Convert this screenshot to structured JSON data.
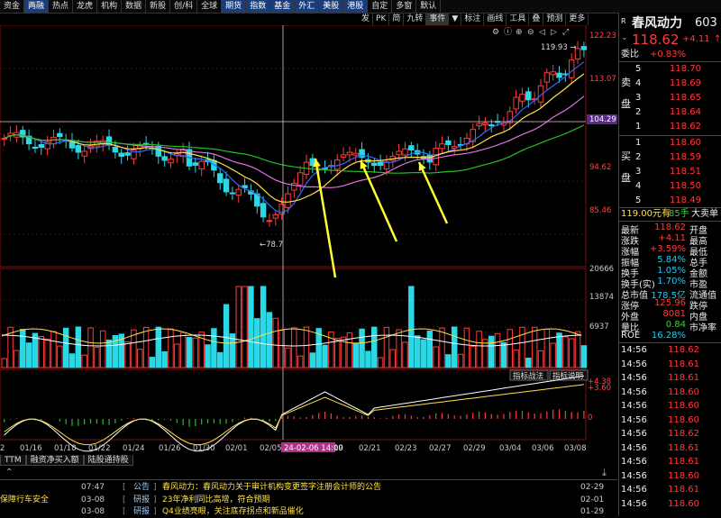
{
  "nav": [
    "资金",
    "两融",
    "热点",
    "龙虎",
    "机构",
    "数据",
    "新股",
    "创/科",
    "全球",
    "期货",
    "指数",
    "基金",
    "外汇",
    "美股",
    "港股",
    "自定",
    "多窗",
    "默认"
  ],
  "toolbar2": [
    "发",
    "PK",
    "简",
    "九转",
    "事件",
    "▼",
    "标注",
    "画线",
    "工具",
    "叠",
    "预测",
    "更多"
  ],
  "stock": {
    "name": "春风动力",
    "code": "603",
    "price": "118.62",
    "change": "+4.11",
    "r": "R",
    "wei_label": "委比",
    "wei_val": "+0.83%"
  },
  "asks": [
    {
      "n": "5",
      "p": "118.70"
    },
    {
      "n": "4",
      "p": "118.69"
    },
    {
      "n": "3",
      "p": "118.65"
    },
    {
      "n": "2",
      "p": "118.64"
    },
    {
      "n": "1",
      "p": "118.62"
    }
  ],
  "ask_label": [
    "卖",
    "盘"
  ],
  "bids": [
    {
      "n": "1",
      "p": "118.60"
    },
    {
      "n": "2",
      "p": "118.59"
    },
    {
      "n": "3",
      "p": "118.51"
    },
    {
      "n": "4",
      "p": "118.50"
    },
    {
      "n": "5",
      "p": "118.49"
    }
  ],
  "bid_label": [
    "买",
    "盘"
  ],
  "big": {
    "text": "119.00元有",
    "qty": "85手",
    "label": "大卖单"
  },
  "quote": [
    {
      "k": "最新",
      "v": "118.62",
      "k2": "开盘"
    },
    {
      "k": "涨跌",
      "v": "+4.11",
      "k2": "最高"
    },
    {
      "k": "涨幅",
      "v": "+3.59%",
      "k2": "最低"
    },
    {
      "k": "振幅",
      "v": "5.84%",
      "k2": "总手"
    },
    {
      "k": "换手",
      "v": "1.05%",
      "k2": "金额"
    },
    {
      "k": "换手(实)",
      "v": "1.70%",
      "k2": "市盈"
    },
    {
      "k": "总市值",
      "v": "178.5亿",
      "k2": "流通值"
    },
    {
      "k": "涨停",
      "v": "125.96",
      "k2": "跌停"
    },
    {
      "k": "外盘",
      "v": "8081",
      "k2": "内盘"
    },
    {
      "k": "量比",
      "v": "0.84",
      "k2": "市净率"
    },
    {
      "k": "ROE",
      "v": "16.28%",
      "k2": ""
    }
  ],
  "ticks": [
    {
      "t": "14:56",
      "p": "118.62"
    },
    {
      "t": "14:56",
      "p": "118.61"
    },
    {
      "t": "14:56",
      "p": "118.61"
    },
    {
      "t": "14:56",
      "p": "118.60"
    },
    {
      "t": "14:56",
      "p": "118.60"
    },
    {
      "t": "14:56",
      "p": "118.60"
    },
    {
      "t": "14:56",
      "p": "118.62"
    },
    {
      "t": "14:56",
      "p": "118.61"
    },
    {
      "t": "14:56",
      "p": "118.61"
    },
    {
      "t": "14:56",
      "p": "118.60"
    },
    {
      "t": "14:56",
      "p": "118.61"
    },
    {
      "t": "14:56",
      "p": "118.60"
    }
  ],
  "price_axis": [
    "122.23",
    "113.07",
    "104.29",
    "94.62",
    "85.46"
  ],
  "vol_axis": [
    "20666",
    "13874",
    "6937"
  ],
  "macd_axis": [
    "4.38",
    "3.60",
    "0"
  ],
  "chart_labels": {
    "high": "119.93",
    "low": "78.7",
    "cross": "104.29",
    "cursor_date": "24-02-06 14:00"
  },
  "dates": [
    "2",
    "01/16",
    "01/18",
    "01/22",
    "01/24",
    "01/26",
    "01/30",
    "02/01",
    "02/05",
    "19",
    "02/21",
    "02/23",
    "02/27",
    "02/29",
    "03/04",
    "03/06",
    "03/08"
  ],
  "macd_buttons": [
    "指标战法",
    "指标说明"
  ],
  "bottom_tabs": [
    "TTM",
    "融资净买入额",
    "陆股通持股"
  ],
  "news": [
    {
      "left": "",
      "lt": "07:47",
      "tag": "公告",
      "title": "春风动力：春风动力关于审计机构变更签字注册会计师的公告",
      "date": "02-29"
    },
    {
      "left": "保障行车安全",
      "lt": "03-08",
      "tag": "研报",
      "title": "23年净利同比高增，符合预期",
      "date": "02-01"
    },
    {
      "left": "",
      "lt": "03-08",
      "tag": "研报",
      "title": "Q4业绩亮眼，关注底存拐点和新品催化",
      "date": "01-29"
    }
  ]
}
